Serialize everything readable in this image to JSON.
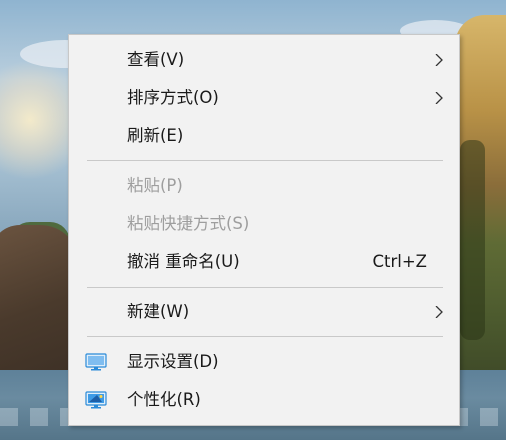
{
  "menu": {
    "items": [
      {
        "label": "查看(V)",
        "submenu": true,
        "enabled": true
      },
      {
        "label": "排序方式(O)",
        "submenu": true,
        "enabled": true
      },
      {
        "label": "刷新(E)",
        "submenu": false,
        "enabled": true
      },
      {
        "label": "粘贴(P)",
        "submenu": false,
        "enabled": false
      },
      {
        "label": "粘贴快捷方式(S)",
        "submenu": false,
        "enabled": false
      },
      {
        "label": "撤消 重命名(U)",
        "shortcut": "Ctrl+Z",
        "submenu": false,
        "enabled": true
      },
      {
        "label": "新建(W)",
        "submenu": true,
        "enabled": true
      },
      {
        "label": "显示设置(D)",
        "icon": "display-settings-icon",
        "submenu": false,
        "enabled": true
      },
      {
        "label": "个性化(R)",
        "icon": "personalization-icon",
        "submenu": false,
        "enabled": true
      }
    ]
  },
  "colors": {
    "menu_background": "#f2f2f2",
    "text": "#1a1a1a",
    "disabled_text": "#9e9e9e",
    "separator": "#c9c9c9",
    "icon_blue": "#2a8ad8"
  }
}
